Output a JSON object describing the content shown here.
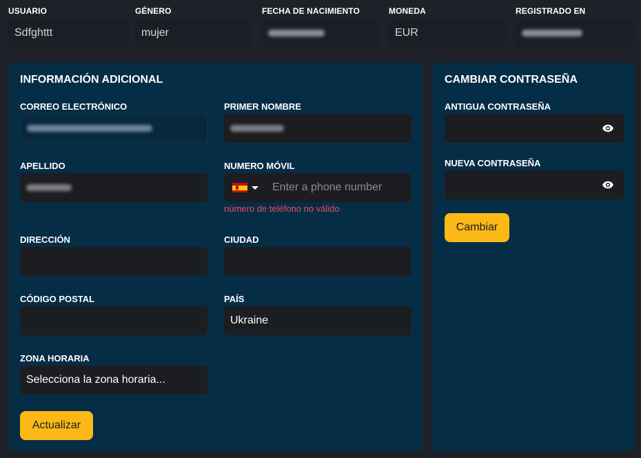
{
  "summary": {
    "usuario": {
      "label": "USUARIO",
      "value": "Sdfghttt"
    },
    "genero": {
      "label": "GÉNERO",
      "value": "mujer"
    },
    "fecha_nacimiento": {
      "label": "FECHA DE NACIMIENTO"
    },
    "moneda": {
      "label": "MONEDA",
      "value": "EUR"
    },
    "registrado": {
      "label": "REGISTRADO EN"
    }
  },
  "info": {
    "title": "INFORMACIÓN ADICIONAL",
    "email_label": "CORREO ELECTRÓNICO",
    "first_name_label": "PRIMER NOMBRE",
    "last_name_label": "APELLIDO",
    "phone_label": "NUMERO MÓVIL",
    "phone_placeholder": "Enter a phone number",
    "phone_error": "número de teléfono no válido",
    "address_label": "DIRECCIÓN",
    "city_label": "CIUDAD",
    "postal_label": "CÓDIGO POSTAL",
    "country_label": "PAÍS",
    "country_value": "Ukraine",
    "timezone_label": "ZONA HORARIA",
    "timezone_value": "Selecciona la zona horaria...",
    "update_button": "Actualizar"
  },
  "password": {
    "title": "CAMBIAR CONTRASEÑA",
    "old_label": "ANTIGUA CONTRASEÑA",
    "new_label": "NUEVA CONTRASEÑA",
    "change_button": "Cambiar"
  },
  "icons": {
    "phone_country_flag": "spain-flag-icon",
    "phone_country_caret": "caret-down-icon",
    "password_toggle": "eye-icon"
  },
  "colors": {
    "page_bg": "#1e2228",
    "panel_bg": "#062d46",
    "input_bg": "#1c1d21",
    "accent": "#fbb917",
    "error": "#f0465a"
  }
}
